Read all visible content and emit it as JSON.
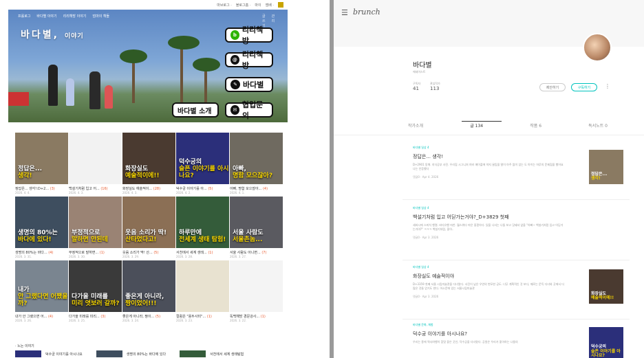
{
  "left": {
    "top_nav": [
      "마브로그 ·",
      "블로그홈 ·",
      "마이",
      "엠배 ·"
    ],
    "blog_menu": [
      "프롤로그",
      "바다별 이야기",
      "리리책방 이야기",
      "엄마의 책들"
    ],
    "blog_menu_right": [
      "글쓰기",
      "관리"
    ],
    "banner_title": "바다별,",
    "banner_title_small": "이야기",
    "buttons": {
      "riri1": "리리책방",
      "riri2": "리리책방",
      "badabyeol": "바다별",
      "intro": "바다별 소개",
      "contact": "협업문의"
    },
    "thumbs": [
      {
        "label": "정답은... 생각!:D+2...",
        "count": "(3)",
        "date": "2026. 4. 4.",
        "cap1": "정답은...",
        "cap2": "생각!",
        "bg": "#8a7a62"
      },
      {
        "label": "백설기처럼 입고 어...",
        "count": "(16)",
        "date": "2026. 4. 3.",
        "cap1": "",
        "cap2": "",
        "bg": "#f2f2f2"
      },
      {
        "label": "화장실도 예술적이...",
        "count": "(28)",
        "date": "2026. 4. 3.",
        "cap1": "화장실도",
        "cap2": "예술적이에!!",
        "bg": "#4a3a30"
      },
      {
        "label": "덕수궁 이야기를 아...",
        "count": "(5)",
        "date": "2026. 4. 2.",
        "cap1": "덕수궁의",
        "cap2": "슬픈 이야기를 아시나요?",
        "bg": "#2b2f7a"
      },
      {
        "label": "아빠, 명함 모으잖아...",
        "count": "(4)",
        "date": "2026. 4. 1.",
        "cap1": "아빠,",
        "cap2": "명함 모으잖아?",
        "bg": "#6f6a60"
      },
      {
        "label": "생명의 80%는 바다...",
        "count": "(4)",
        "date": "2026. 3. 31.",
        "cap1": "생명의 80%는",
        "cap2": "바다에 있다!",
        "bg": "#3e4e5f"
      },
      {
        "label": "부정적으로 말하면...",
        "count": "(1)",
        "date": "2026. 3. 30.",
        "cap1": "부정적으로",
        "cap2": "말하면 안된데",
        "bg": "#9a8374"
      },
      {
        "label": "웃음 소리가 딱! 산...",
        "count": "(5)",
        "date": "2026. 3. 29.",
        "cap1": "웃음 소리가 딱!",
        "cap2": "산타었다고!",
        "bg": "#8b6f55"
      },
      {
        "label": "서천에서 세계 생태...",
        "count": "(1)",
        "date": "2026. 3. 28.",
        "cap1": "하루만에",
        "cap2": "전세계 생태 탐험!",
        "bg": "#345c3a"
      },
      {
        "label": "서울 사람도 아니면...",
        "count": "(7)",
        "date": "2026. 3. 27.",
        "cap1": "서울 사람도",
        "cap2": "서울촌놈...",
        "bg": "#5a5a60"
      },
      {
        "label": "내가 안 그랬으면 어...",
        "count": "(4)",
        "date": "2026. 3. 26.",
        "cap1": "내가",
        "cap2": "안 그랬다면 어쨌을까?",
        "bg": "#7a8590"
      },
      {
        "label": "다가올 미래를 미리...",
        "count": "(3)",
        "date": "2026. 3. 25.",
        "cap1": "다가올 미래를",
        "cap2": "미리 엿보러 갈까?",
        "bg": "#3a3a3a"
      },
      {
        "label": "좋은게 아니라, 짱이...",
        "count": "(5)",
        "date": "2026. 3. 24.",
        "cap1": "좋은게 아니라,",
        "cap2": "짱이었어!!!",
        "bg": "#4b4f5a"
      },
      {
        "label": "컬럼은 \"용두사미\"...",
        "count": "(1)",
        "date": "2026. 3. 23.",
        "cap1": "",
        "cap2": "",
        "bg": "#e8e2d0"
      },
      {
        "label": "독백해방 경문강사...",
        "count": "(1)",
        "date": "2026. 3. 22.",
        "cap1": "",
        "cap2": "",
        "bg": "#f4f4f4"
      }
    ],
    "section_label": "· 노는 이야기",
    "bottom_items": [
      "덕수궁 이야기를 아시나요",
      "생명의 80%는 바다에 있다",
      "서천에서 세계 생태탐험"
    ]
  },
  "right": {
    "logo": "brunch",
    "profile_name": "바다별",
    "profile_sub": "에세이스트",
    "followers_label": "구독자",
    "followers": "41",
    "following_label": "관심작가",
    "following": "113",
    "suggest_btn": "제안하기",
    "subscribe_btn": "구독하기",
    "tabs": [
      "작가소개",
      "글 134",
      "작품 6",
      "독서노트 0"
    ],
    "posts": [
      {
        "cat": "바다별 일상 4",
        "title": "정답은... 생각!",
        "desc": "D+2901 동해. 지식공부 사진. 우리집 시그니처 여러 메이플에 약지 꿀팁을 딸이 아주 많이 있는 도 아이는 하루의 문제집을 했어요 나는 인증했다",
        "meta": "댓글0 · Apr 4. 2026",
        "cap1": "정답은...",
        "cap2": "생각!",
        "bg": "#8a7a62"
      },
      {
        "cat": "바다별 일상 4",
        "title": "백설기처럼 입고 어딛가는거야?_D+3829 첫째",
        "desc": "세바시에 스피치 행렬. 바다유행 마찬. 월스위다 마은 좋겠아다. 있을 나서는 나들 보고 깃돼셔 앞을 \"아빠~ 백설기처럼 입고 어딛가는거야?\" ㅋㅋㅋ 백설기처럼, 좋아..",
        "meta": "댓글0 · Apr 3. 2026",
        "cap1": "",
        "cap2": "",
        "bg": "#ffffff"
      },
      {
        "cat": "바다별 일상 4",
        "title": "화장실도 예술적이야",
        "desc": "D+3359 첫째 서울 시립미술관을 다녀왔다. 사진이 남은 우연의 변모한 공도. 너무 계획적인 것 보다, 때로는 문득 다녀와 곳에서 더 많은 것들 얻기도 한다. 어소문에 있는 서울시립미술관",
        "meta": "댓글0 · Apr 3. 2026",
        "cap1": "화장실도",
        "cap2": "예술적이에!!",
        "bg": "#4a3a30"
      },
      {
        "cat": "바다별 문화, 체험",
        "title": "덕수궁 이야기를 아시나요?",
        "desc": "우리는 종에 역사여행이 참멋 좋은 곳인, 덕수궁을 다녀왔다. 공원은 우리가 좋아하는 나들의",
        "meta": "",
        "cap1": "덕수궁의",
        "cap2": "슬픈 이야기를 아시나요?",
        "bg": "#2b2f7a"
      }
    ]
  }
}
